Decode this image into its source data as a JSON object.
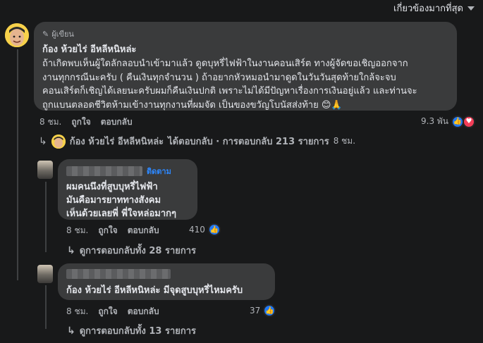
{
  "sort": {
    "label": "เกี่ยวข้องมากที่สุด"
  },
  "main_comment": {
    "author_badge": "ผู้เขียน",
    "name": "ก้อง ห้วยไร่ อีหลีหนิหล่ะ",
    "text_lines": [
      "ถ้าเกิดพบเห็นผู้ใดลักลอบนำเข้ามาแล้ว ดูดบุหรี่ไฟฟ้าในงานคอนเสิร์ต ทางผู้จัดขอเชิญออกจาก",
      "งานทุกกรณีนะครับ ( คืนเงินทุกจำนวน ) ถ้าอยากหัวหมอนำมาดูดในวันวันสุดท้ายใกล้จะจบ",
      "คอนเสิร์ตก็เชิญได้เลยนะครับผมก็คืนเงินปกติ เพราะไม่ได้มีปัญหาเรื่องการเงินอยู่แล้ว และท่านจะ",
      "ถูกแบนตลอดชีวิตห้ามเข้างานทุกงานที่ผมจัด เป็นของขวัญโบนัสส่งท้าย 😊🙏"
    ],
    "time": "8 ชม.",
    "like": "ถูกใจ",
    "reply": "ตอบกลับ",
    "reaction_count": "9.3 พัน",
    "reply_summary_name": "ก้อง ห้วยไร่ อีหลีหนิหล่ะ",
    "reply_summary_text": "ได้ตอบกลับ · การตอบกลับ 213 รายการ",
    "reply_summary_time": "8 ชม."
  },
  "reply1": {
    "follow": "ติดตาม",
    "text_lines": [
      "ผมคนนึงที่สูบบุหรี่ไฟฟ้า",
      "มันคือมารยาททางสังคม",
      "เห็นด้วยเลยพี่ พี่ใจหล่อมากๆ"
    ],
    "time": "8 ชม.",
    "like": "ถูกใจ",
    "reply": "ตอบกลับ",
    "reaction_count": "410",
    "view_replies": "ดูการตอบกลับทั้ง 28 รายการ"
  },
  "reply2": {
    "text": "ก้อง ห้วยไร่ อีหลีหนิหล่ะ มีจุดสูบบุหรี่ไหมครับ",
    "time": "8 ชม.",
    "like": "ถูกใจ",
    "reply": "ตอบกลับ",
    "reaction_count": "37",
    "view_replies": "ดูการตอบกลับทั้ง 13 รายการ"
  },
  "colors": {
    "background": "#18191a",
    "bubble": "#3a3b3c",
    "like_blue": "#2078f4",
    "love_red": "#f33e58",
    "follow_blue": "#2d88ff"
  },
  "icons": [
    "pencil-icon",
    "caret-down-icon",
    "like-reaction-icon",
    "love-reaction-icon",
    "reply-arrow-icon"
  ]
}
